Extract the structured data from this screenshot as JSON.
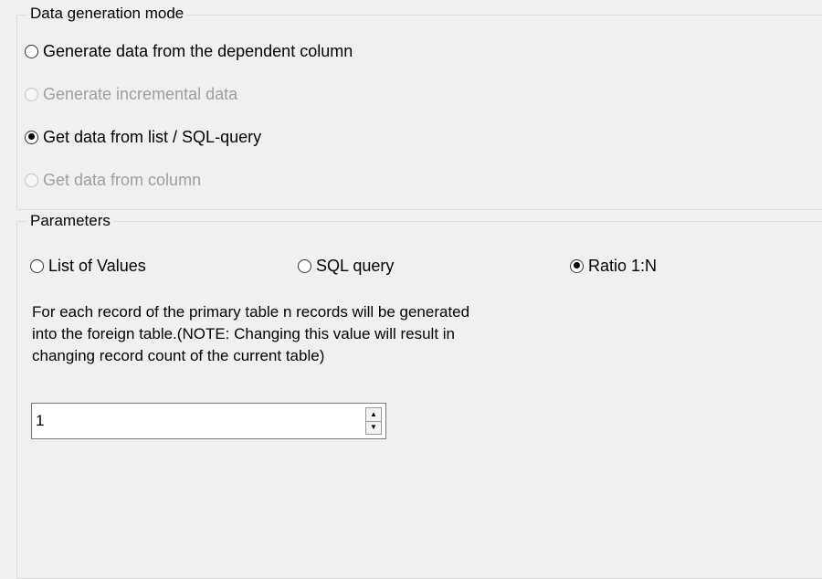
{
  "mode_group": {
    "title": "Data generation mode",
    "options": [
      {
        "label": "Generate data from the dependent column",
        "checked": false,
        "disabled": false
      },
      {
        "label": "Generate incremental data",
        "checked": false,
        "disabled": true
      },
      {
        "label": "Get data from list / SQL-query",
        "checked": true,
        "disabled": false
      },
      {
        "label": "Get data from column",
        "checked": false,
        "disabled": true
      }
    ]
  },
  "params_group": {
    "title": "Parameters",
    "options": [
      {
        "label": "List of Values",
        "checked": false
      },
      {
        "label": "SQL query",
        "checked": false
      },
      {
        "label": "Ratio 1:N",
        "checked": true
      }
    ],
    "note_lines": [
      "For each record of the primary table n records will be generated",
      "into the foreign table.(NOTE: Changing this value will  result in",
      "changing record count of the current table)"
    ],
    "ratio_value": "1",
    "spin_up_icon": "triangle-up-icon",
    "spin_down_icon": "triangle-down-icon"
  }
}
